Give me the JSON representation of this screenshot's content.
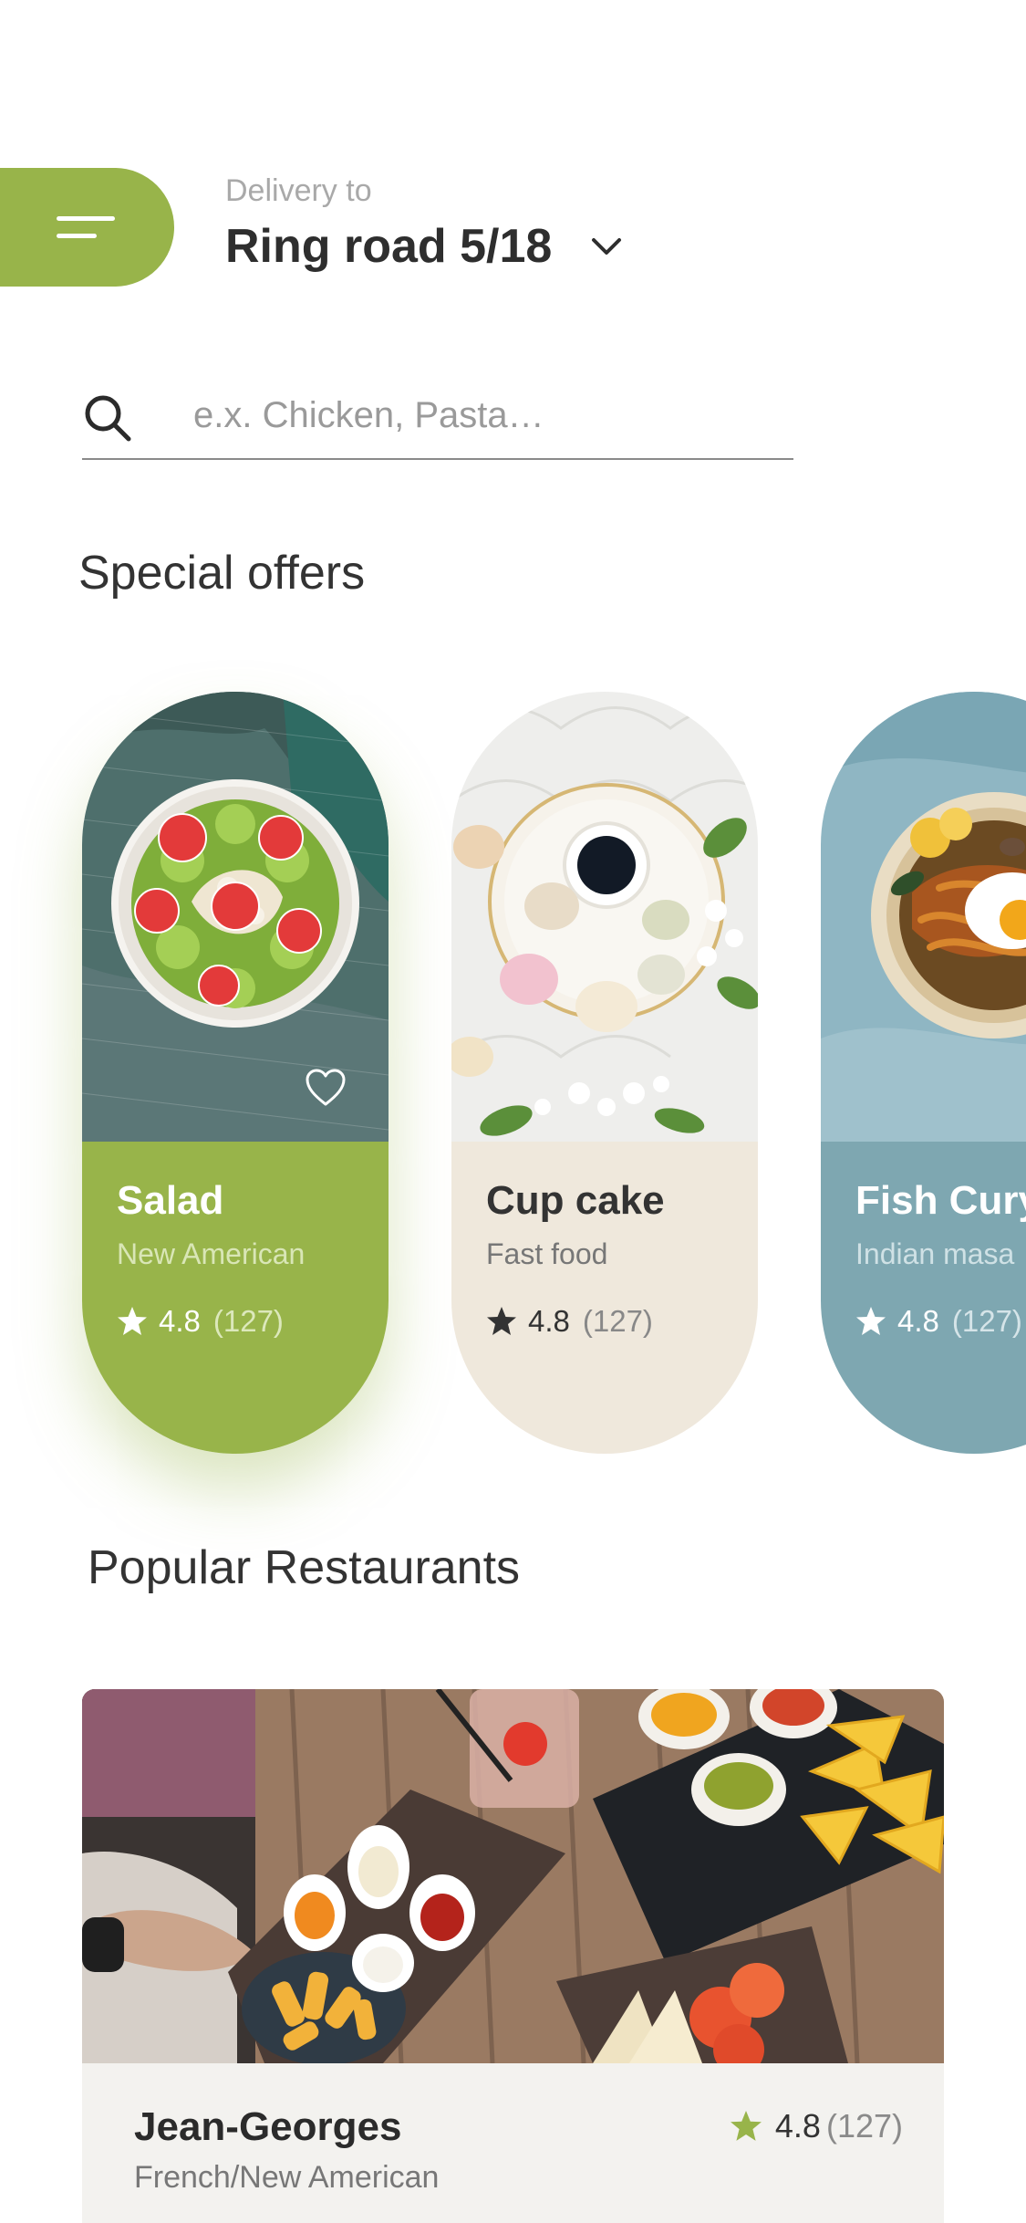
{
  "header": {
    "delivery_label": "Delivery to",
    "address": "Ring road 5/18",
    "menu_icon": "hamburger-menu-icon",
    "dropdown_icon": "chevron-down-icon",
    "accent_color": "#98b44a"
  },
  "search": {
    "placeholder": "e.x. Chicken, Pasta…",
    "value": "",
    "icon": "search-icon"
  },
  "special_offers": {
    "title": "Special offers",
    "items": [
      {
        "name": "Salad",
        "cuisine": "New American",
        "rating": "4.8",
        "reviews": "(127)",
        "color": "#98b44a",
        "image": "salad-bowl-image",
        "favorite_icon": "heart-icon"
      },
      {
        "name": "Cup cake",
        "cuisine": "Fast food",
        "rating": "4.8",
        "reviews": "(127)",
        "color": "#efe8dc",
        "image": "macarons-coffee-image"
      },
      {
        "name": "Fish Cury",
        "cuisine": "Indian masa",
        "rating": "4.8",
        "reviews": "(127)",
        "color": "#7ea7b1",
        "image": "fish-curry-plate-image"
      }
    ]
  },
  "popular_restaurants": {
    "title": "Popular Restaurants",
    "items": [
      {
        "name": "Jean-Georges",
        "cuisine": "French/New American",
        "rating": "4.8",
        "reviews": "(127)",
        "image": "restaurant-table-food-image",
        "star_color": "#98b44a"
      }
    ]
  }
}
